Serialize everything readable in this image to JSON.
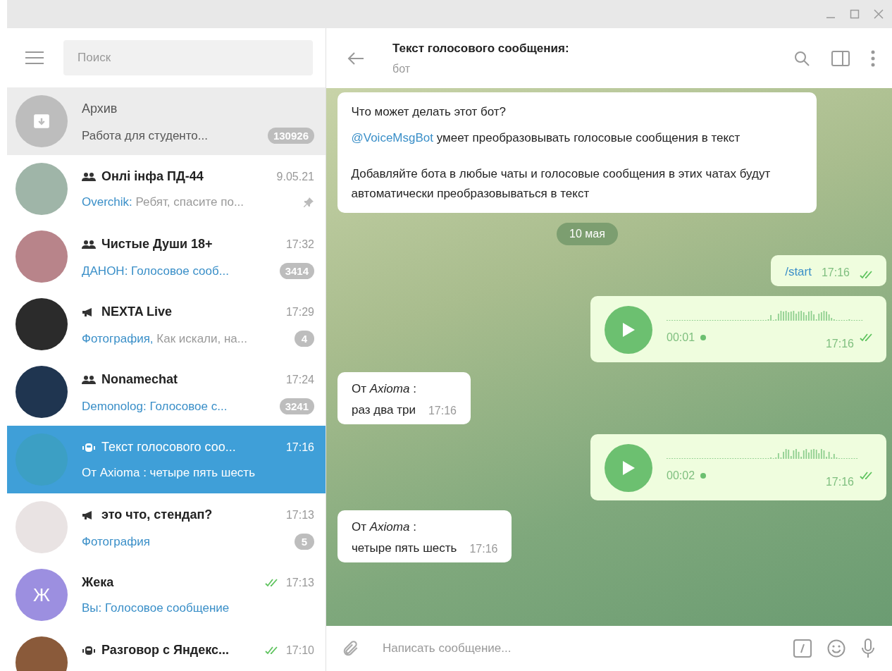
{
  "search": {
    "placeholder": "Поиск"
  },
  "chats": [
    {
      "kind": "archive",
      "name": "Архив",
      "preview": "Работа для студенто...",
      "badge": "130926",
      "pinned": false,
      "read": false,
      "selected": false,
      "color": "#bdbdbd"
    },
    {
      "kind": "group",
      "name": "Онлі інфа ПД-44",
      "time": "9.05.21",
      "sender": "Overchik:",
      "preview": " Ребят, спасите по...",
      "pinned": true,
      "read": false,
      "selected": false,
      "color": "#9fb5a8"
    },
    {
      "kind": "group",
      "name": "Чистые Души 18+",
      "time": "17:32",
      "sender": "ДАНОН: Голосовое сооб...",
      "badge": "3414",
      "pinned": false,
      "read": false,
      "selected": false,
      "color": "#b8848a"
    },
    {
      "kind": "channel",
      "name": "NEXTA Live",
      "time": "17:29",
      "sender": "Фотография,",
      "preview": " Как искали, на...",
      "badge": "4",
      "pinned": false,
      "read": false,
      "selected": false,
      "color": "#2b2b2b"
    },
    {
      "kind": "group",
      "name": "Nonamechat",
      "time": "17:24",
      "sender": "Demonolog: Голосовое с...",
      "badge": "3241",
      "pinned": false,
      "read": false,
      "selected": false,
      "color": "#1f3550"
    },
    {
      "kind": "bot",
      "name": "Текст голосового соо...",
      "time": "17:16",
      "preview": "От Axioma : четыре пять шесть",
      "pinned": false,
      "read": false,
      "selected": true,
      "color": "#3c9fc4"
    },
    {
      "kind": "channel",
      "name": "это что, стендап?",
      "time": "17:13",
      "sender": "Фотография",
      "badge": "5",
      "pinned": false,
      "read": false,
      "selected": false,
      "color": "#e9e3e3"
    },
    {
      "kind": "user",
      "name": "Жека",
      "time": "17:13",
      "sender": "Вы: Голосовое сообщение",
      "letter": "Ж",
      "pinned": false,
      "read": true,
      "selected": false,
      "color": "#9c8fe0"
    },
    {
      "kind": "bot",
      "name": "Разговор с Яндекс...",
      "time": "17:10",
      "pinned": false,
      "read": true,
      "selected": false,
      "color": "#8a5a3a"
    }
  ],
  "chat": {
    "title": "Текст голосового сообщения:",
    "subtitle": "бот",
    "input_placeholder": "Написать сообщение..."
  },
  "messages": [
    {
      "kind": "bot-info",
      "title": "Что может делать этот бот?",
      "mention": "@VoiceMsgBot",
      "text": " умеет преобразовывать голосовые сообщения в текст",
      "text2": "Добавляйте бота в любые чаты и голосовые сообщения в этих чатах будут автоматически преобразовываться в текст"
    },
    {
      "kind": "date",
      "text": "10 мая"
    },
    {
      "kind": "command",
      "text": "/start",
      "time": "17:16",
      "read": true
    },
    {
      "kind": "voice",
      "duration": "00:01",
      "time": "17:16",
      "read": true
    },
    {
      "kind": "incoming",
      "from": "От *Axioma* :",
      "text": "раз два три",
      "time": "17:16"
    },
    {
      "kind": "voice",
      "duration": "00:02",
      "time": "17:16",
      "read": true
    },
    {
      "kind": "incoming",
      "from": "От *Axioma* :",
      "text": "четыре пять шесть",
      "time": "17:16"
    }
  ]
}
